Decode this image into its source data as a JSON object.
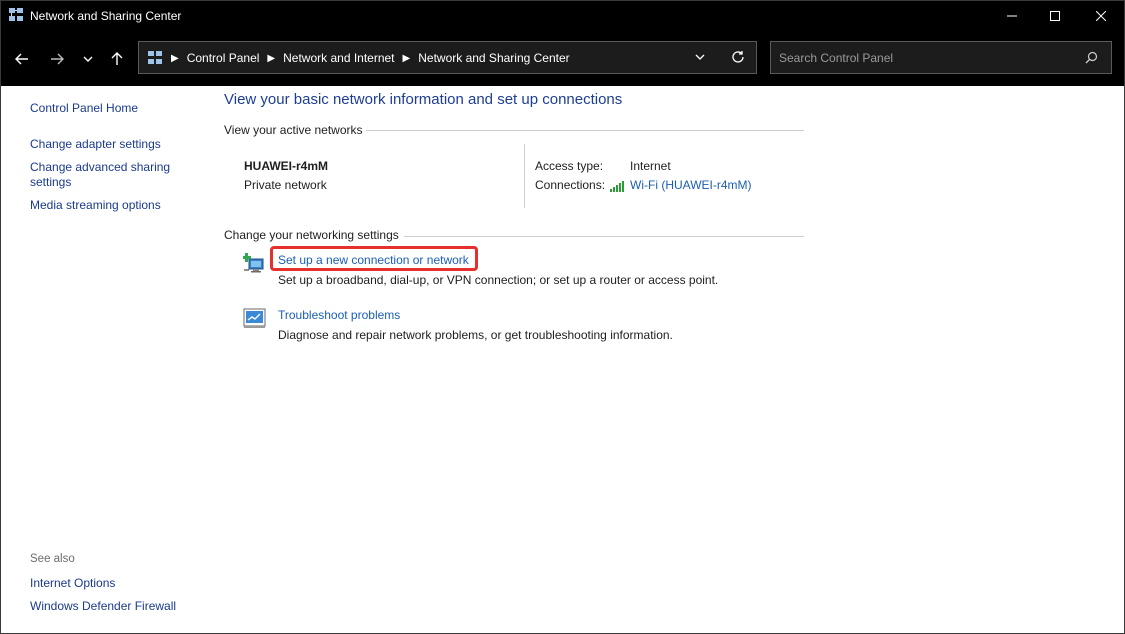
{
  "window": {
    "title": "Network and Sharing Center"
  },
  "address": {
    "crumbs": [
      "Control Panel",
      "Network and Internet",
      "Network and Sharing Center"
    ],
    "search_placeholder": "Search Control Panel"
  },
  "left_pane": {
    "links": [
      "Control Panel Home",
      "Change adapter settings",
      "Change advanced sharing settings",
      "Media streaming options"
    ],
    "see_also_label": "See also",
    "see_also_links": [
      "Internet Options",
      "Windows Defender Firewall"
    ]
  },
  "main": {
    "title": "View your basic network information and set up connections",
    "active_networks_label": "View your active networks",
    "network": {
      "name": "HUAWEI-r4mM",
      "type": "Private network",
      "access_type_label": "Access type:",
      "access_type_value": "Internet",
      "connections_label": "Connections:",
      "connections_value": "Wi-Fi (HUAWEI-r4mM)"
    },
    "settings_label": "Change your networking settings",
    "tasks": [
      {
        "link": "Set up a new connection or network",
        "description": "Set up a broadband, dial-up, or VPN connection; or set up a router or access point.",
        "icon": "new-connection-icon"
      },
      {
        "link": "Troubleshoot problems",
        "description": "Diagnose and repair network problems, or get troubleshooting information.",
        "icon": "troubleshoot-icon"
      }
    ]
  },
  "colors": {
    "chrome": "#000000",
    "link": "#1a5fb4",
    "title": "#1e3e94",
    "highlight": "#e5302d"
  }
}
